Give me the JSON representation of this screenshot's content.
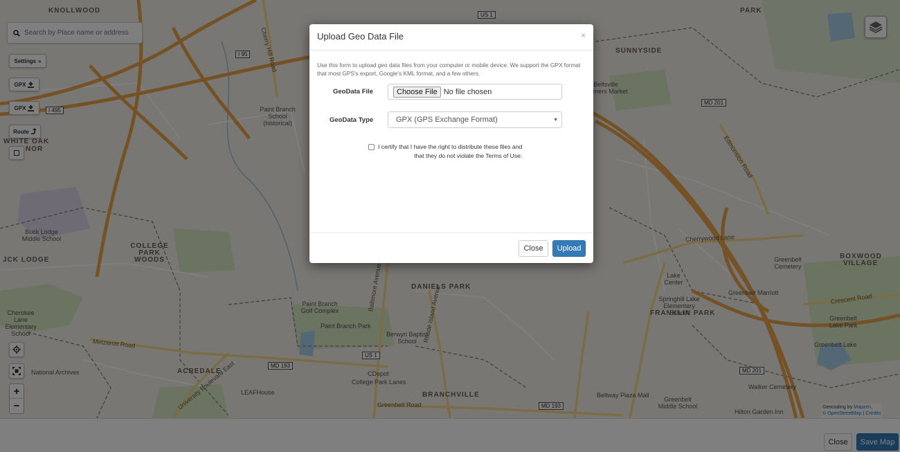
{
  "map": {
    "search_placeholder": "Search by Place name or address",
    "controls": {
      "settings_label": "Settings",
      "settings_icon": "double-chevron-right-icon",
      "gpx_upload_label": "GPX",
      "gpx_download_label": "GPX",
      "route_label": "Route",
      "zoom_in": "+",
      "zoom_out": "−"
    },
    "labels": [
      {
        "text": "KNOLLWOOD",
        "kind": "area"
      },
      {
        "text": "PARK",
        "kind": "area"
      },
      {
        "text": "SUNNYSIDE",
        "kind": "area"
      },
      {
        "text": "WHITE OAK",
        "kind": "area"
      },
      {
        "text": "NOR",
        "kind": "area"
      },
      {
        "text": "COLLEGE PARK WOODS",
        "kind": "area"
      },
      {
        "text": "JCK LODGE",
        "kind": "area"
      },
      {
        "text": "DANIELS PARK",
        "kind": "area"
      },
      {
        "text": "FRANKLIN PARK",
        "kind": "area"
      },
      {
        "text": "BOXWOOD VILLAGE",
        "kind": "area"
      },
      {
        "text": "ACREDALE",
        "kind": "area"
      },
      {
        "text": "BRANCHVILLE",
        "kind": "area"
      },
      {
        "text": "Paint Branch School (historical)",
        "kind": "poi"
      },
      {
        "text": "Buck Lodge Middle School",
        "kind": "poi"
      },
      {
        "text": "Paint Branch Golf Complex",
        "kind": "poi"
      },
      {
        "text": "Paint Branch Park",
        "kind": "poi"
      },
      {
        "text": "Berwyn Baptist School",
        "kind": "poi"
      },
      {
        "text": "Cherokee Lane Elementary School",
        "kind": "poi"
      },
      {
        "text": "National Archives",
        "kind": "poi"
      },
      {
        "text": "CDepot",
        "kind": "poi"
      },
      {
        "text": "College Park Lanes",
        "kind": "poi"
      },
      {
        "text": "LEAFHouse",
        "kind": "poi"
      },
      {
        "text": "Lake Center",
        "kind": "poi"
      },
      {
        "text": "Springhill Lake Elementary School",
        "kind": "poi"
      },
      {
        "text": "Greenbelt Marriott",
        "kind": "poi"
      },
      {
        "text": "Greenbelt Cemetery",
        "kind": "poi"
      },
      {
        "text": "Greenbelt Lake Park",
        "kind": "poi"
      },
      {
        "text": "Greenbelt Lake",
        "kind": "poi"
      },
      {
        "text": "Beltway Plaza Mall",
        "kind": "poi"
      },
      {
        "text": "Greenbelt Middle School",
        "kind": "poi"
      },
      {
        "text": "Walker Cemetery",
        "kind": "poi"
      },
      {
        "text": "Hilton Garden Inn",
        "kind": "poi"
      },
      {
        "text": "Beltsville Farmers Market",
        "kind": "poi"
      }
    ],
    "shields": [
      "US 1",
      "I 95",
      "I 495",
      "MD 201",
      "MD 193",
      "US 1",
      "MD 193",
      "MD 201"
    ],
    "roads": [
      "Metzerott Road",
      "Greenbelt Road",
      "Cherrywood Lane",
      "Crescent Road",
      "Edmonston Road",
      "Baltimore Avenue",
      "Rhode Island Avenue",
      "University Boulevard East",
      "Cherry Hill Road"
    ],
    "attribution": {
      "geocoding_prefix": "Geocoding by",
      "geocoding_link": "Mapzen",
      "osm_link": "© OpenStreetMap",
      "separator": "|",
      "credits_link": "Credits"
    }
  },
  "modal": {
    "title": "Upload Geo Data File",
    "close_symbol": "×",
    "description": "Use this form to upload geo data files from your computer or mobile device. We support the GPX format that most GPS's export, Google's KML format, and a few others.",
    "file_label": "GeoData File",
    "file_button": "Choose File",
    "file_status": "No file chosen",
    "type_label": "GeoData Type",
    "type_selected": "GPX (GPS Exchange Format)",
    "certify_line1": "I certify that I have the right to distribute these files and",
    "certify_line2": "that they do not violate the Terms of Use:",
    "close_button": "Close",
    "upload_button": "Upload"
  },
  "bottombar": {
    "close_button": "Close",
    "save_button": "Save Map"
  },
  "colors": {
    "primary": "#337ab7",
    "map_bg": "#f2efe9",
    "motorway": "#e8a94a",
    "park": "#c8dfb0",
    "water": "#a9cfe8"
  }
}
